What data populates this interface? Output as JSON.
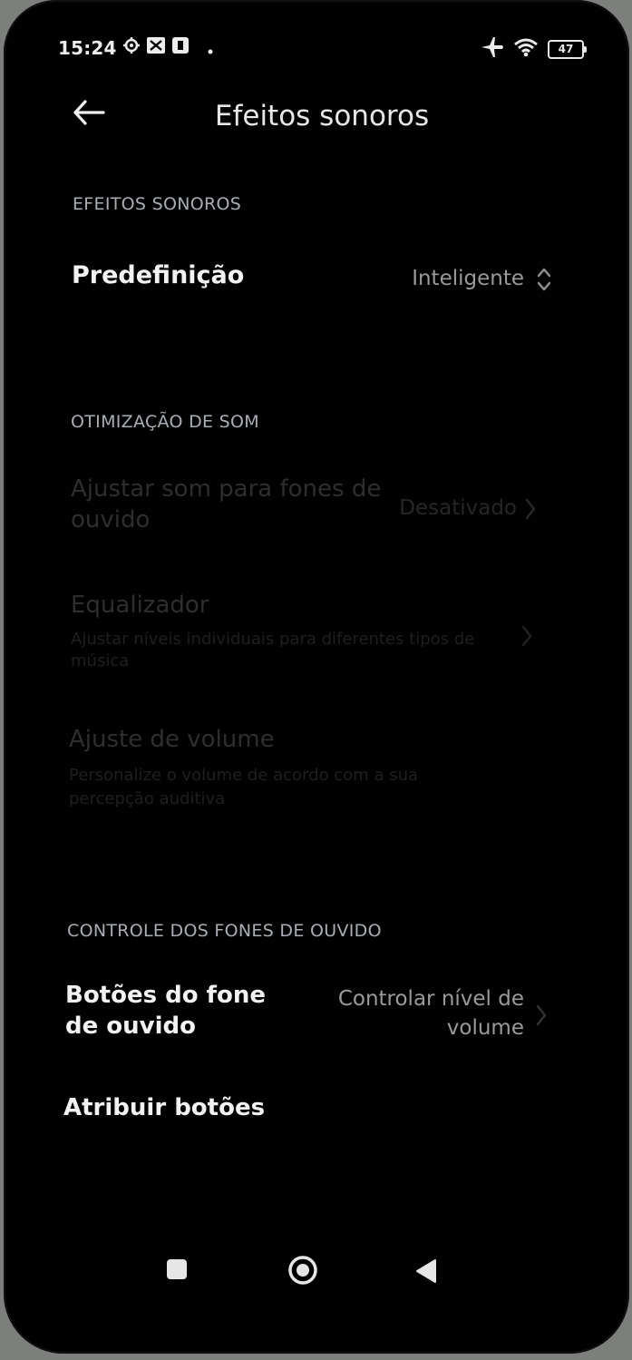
{
  "status_bar": {
    "time": "15:24",
    "battery": "47",
    "icons": [
      "settings-gear-icon",
      "cast-icon",
      "app-icon",
      "dot-icon",
      "airplane-icon",
      "wifi-icon",
      "battery-icon"
    ]
  },
  "header": {
    "title": "Efeitos sonoros",
    "back_icon": "back-arrow-icon"
  },
  "sections": {
    "effects": {
      "label": "EFEITOS SONOROS",
      "preset_title": "Predefinição",
      "preset_value": "Inteligente"
    },
    "optimization": {
      "label": "OTIMIZAÇÃO DE SOM",
      "headphones_title_1": "Ajustar som para fones de",
      "headphones_title_2": "ouvido",
      "headphones_value": "Desativado",
      "equalizer_title": "Equalizador",
      "equalizer_sub_1": "Ajustar níveis individuais para diferentes tipos de",
      "equalizer_sub_2": "música",
      "volume_title": "Ajuste de volume",
      "volume_sub_1": "Personalize o volume de acordo com a sua",
      "volume_sub_2": "percepção auditiva"
    },
    "headset_control": {
      "label": "CONTROLE DOS FONES DE OUVIDO",
      "buttons_title_1": "Botões do fone",
      "buttons_title_2": "de ouvido",
      "buttons_value_1": "Controlar nível de",
      "buttons_value_2": "volume",
      "assign_title": "Atribuir botões"
    }
  },
  "nav_bar": {
    "icons": [
      "recents-square-icon",
      "home-circle-icon",
      "back-triangle-icon"
    ]
  },
  "colors": {
    "background": "#010101",
    "primary_text": "#f2f2f2",
    "section_label": "#a9aeb4",
    "value_text": "#9a9a9a",
    "disabled_text": "#2e2e2e"
  }
}
